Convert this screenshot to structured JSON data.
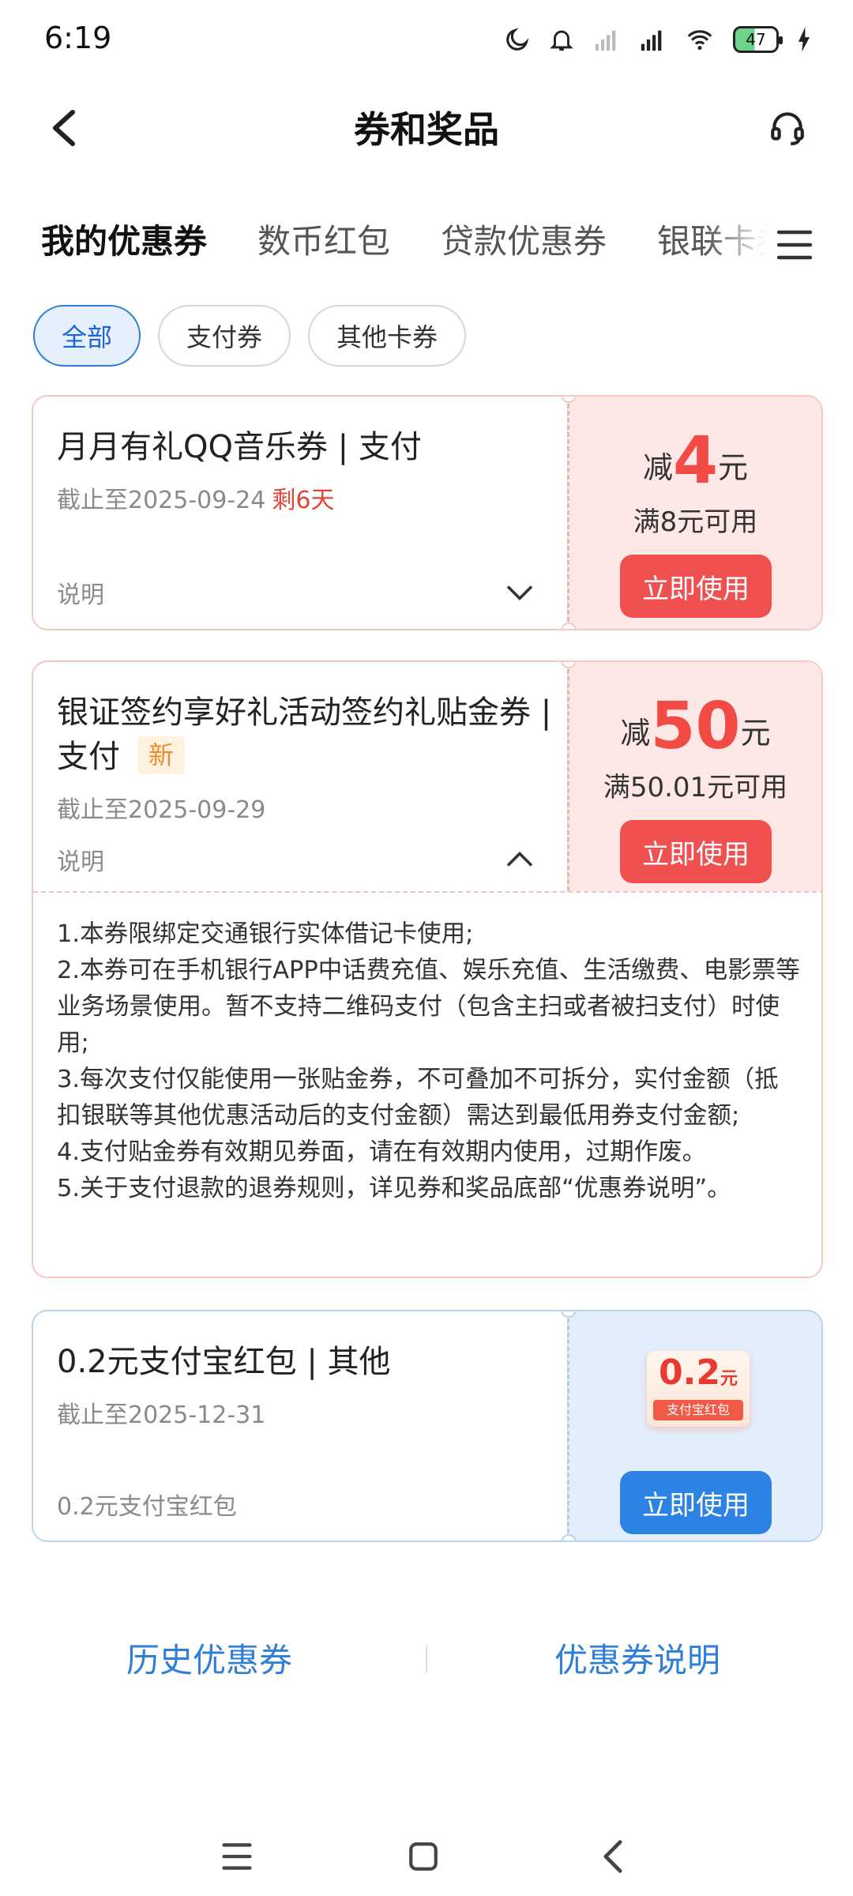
{
  "status_bar": {
    "time": "6:19",
    "battery": "47"
  },
  "header": {
    "title": "券和奖品"
  },
  "tabs": [
    {
      "label": "我的优惠券",
      "active": true
    },
    {
      "label": "数币红包",
      "active": false
    },
    {
      "label": "贷款优惠券",
      "active": false
    },
    {
      "label": "银联卡券",
      "active": false
    }
  ],
  "filters": [
    {
      "label": "全部",
      "active": true
    },
    {
      "label": "支付券",
      "active": false
    },
    {
      "label": "其他卡券",
      "active": false
    }
  ],
  "coupons": [
    {
      "title": "月月有礼QQ音乐券 | 支付",
      "expiry": "截止至2025-09-24",
      "remaining": "剩6天",
      "desc_label": "说明",
      "amount_prefix": "减",
      "amount_value": "4",
      "amount_unit": "元",
      "threshold": "满8元可用",
      "button": "立即使用"
    },
    {
      "title": "银证签约享好礼活动签约礼贴金券 | 支付",
      "badge": "新",
      "expiry": "截止至2025-09-29",
      "desc_label": "说明",
      "amount_prefix": "减",
      "amount_value": "50",
      "amount_unit": "元",
      "threshold": "满50.01元可用",
      "button": "立即使用",
      "details": [
        "1.本券限绑定交通银行实体借记卡使用;",
        "2.本券可在手机银行APP中话费充值、娱乐充值、生活缴费、电影票等业务场景使用。暂不支持二维码支付（包含主扫或者被扫支付）时使用;",
        "3.每次支付仅能使用一张贴金券，不可叠加不可拆分，实付金额（抵扣银联等其他优惠活动后的支付金额）需达到最低用券支付金额;",
        "4.支付贴金券有效期见券面，请在有效期内使用，过期作废。",
        "5.关于支付退款的退券规则，详见券和奖品底部“优惠券说明”。"
      ]
    },
    {
      "title": "0.2元支付宝红包 | 其他",
      "expiry": "截止至2025-12-31",
      "desc_label": "0.2元支付宝红包",
      "image_value": "0.2",
      "image_unit": "元",
      "image_label": "支付宝红包",
      "button": "立即使用"
    }
  ],
  "footer": {
    "history": "历史优惠券",
    "explanation": "优惠券说明"
  },
  "colors": {
    "accent_blue": "#1a64d6",
    "coupon_red": "#f24b45",
    "button_red": "#f05050",
    "button_blue": "#2c83e4"
  },
  "icons": {
    "back": "chevron-left-icon",
    "service": "headset-icon",
    "menu": "hamburger-menu-icon"
  }
}
